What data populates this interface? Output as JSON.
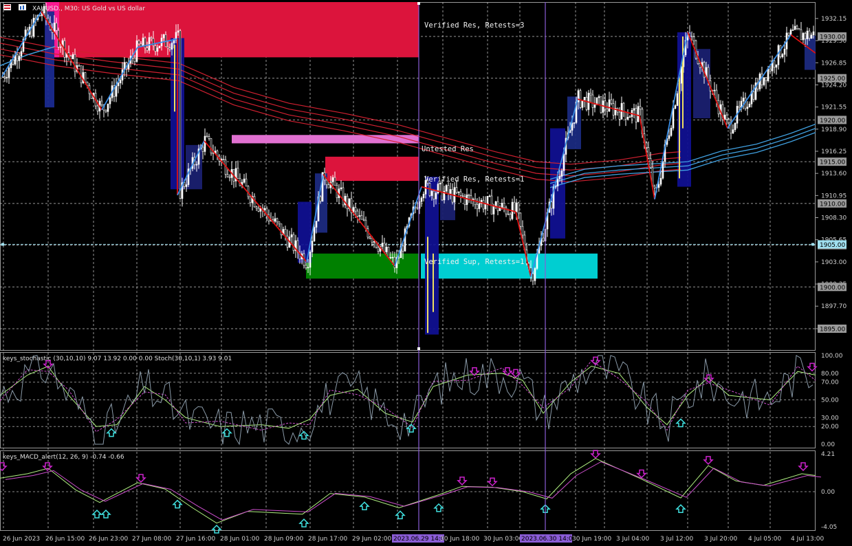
{
  "header": {
    "symbol_text": "XAUUSD., M30:  US Gold vs US dollar"
  },
  "zones": {
    "res1": "Verified Res, Retests=3",
    "res2": "Untested Res",
    "res3": "Verified Res, Retests=1",
    "sup1": "Verified Sup, Retests=1"
  },
  "stoch": {
    "title": "keys_stochastic (30,10,10) 9.07 13.92 0.00 0.00 Stoch(30,10,1) 3.93 9.01",
    "levels": [
      "100.00",
      "80.00",
      "70.00",
      "50.00",
      "30.00",
      "20.00",
      "0.00"
    ]
  },
  "macd": {
    "title": "keys_MACD_alert(12, 26, 9) -0.74 -0.66",
    "levels": [
      "4.21",
      "0.00",
      "-4.05"
    ]
  },
  "time_axis": {
    "labels": [
      "26 Jun 2023",
      "26 Jun 15:00",
      "26 Jun 23:00",
      "27 Jun 08:00",
      "27 Jun 16:00",
      "28 Jun 01:00",
      "28 Jun 09:00",
      "28 Jun 17:00",
      "29 Jun 02:00",
      "2023.06.29 14:00",
      "30 Jun 18:00",
      "30 Jun 03:00",
      "2023.06.30 14:00",
      "30 Jun 19:00",
      "3 Jul 04:00",
      "3 Jul 12:00",
      "3 Jul 20:00",
      "4 Jul 05:00",
      "4 Jul 13:00"
    ],
    "highlight_labels": [
      "2023.06.29 14:00",
      "2023.06.30 14:00"
    ]
  },
  "colors": {
    "background": "#000000",
    "grid": "#c8c8c8",
    "bull": "#ffffff",
    "bear": "#ffffff",
    "res_zone": "#dc143c",
    "untested_zone": "#e070d0",
    "sup_green": "#008000",
    "sup_cyan": "#00ced1",
    "zigzag_up": "#3a8ee6",
    "zigzag_down": "#e01010",
    "ma_red": "#d02030",
    "ma_blue": "#40a0e0",
    "vline": "#8a5cd6",
    "highlight_label_bg": "#8a5cd6",
    "alert_down": "#cc22cc",
    "alert_up": "#40e0e0"
  },
  "chart_data": {
    "type": "candlestick",
    "title": "XAUUSD., M30:  US Gold vs US dollar",
    "price_axis": {
      "ticks": [
        "1932.15",
        "1929.50",
        "1926.85",
        "1924.20",
        "1921.55",
        "1918.90",
        "1916.25",
        "1913.60",
        "1910.95",
        "1908.30",
        "1905.65",
        "1903.00",
        "1900.35",
        "1897.70",
        "1895.00"
      ],
      "boxed_levels": [
        "1930.00",
        "1925.00",
        "1920.00",
        "1915.00",
        "1910.00",
        "1905.00",
        "1900.00",
        "1895.00"
      ],
      "ylim": [
        1893.0,
        1933.5
      ]
    },
    "zigzag_points": [
      {
        "x": "26 Jun 2023",
        "y": 1925.2
      },
      {
        "x": "26 Jun 15:00",
        "y": 1933.0
      },
      {
        "x": "26 Jun 23:00",
        "y": 1921.2
      },
      {
        "x": "27 Jun 08:00",
        "y": 1928.7
      },
      {
        "x": "27 Jun 16:00",
        "y": 1929.7
      },
      {
        "x": "27 Jun 16:00",
        "y": 1911.0
      },
      {
        "x": "28 Jun 01:00",
        "y": 1917.5
      },
      {
        "x": "28 Jun 09:00",
        "y": 1903.0
      },
      {
        "x": "28 Jun 17:00",
        "y": 1913.5
      },
      {
        "x": "29 Jun 02:00",
        "y": 1902.5
      },
      {
        "x": "2023.06.29 14:00",
        "y": 1912.0
      },
      {
        "x": "30 Jun 03:00",
        "y": 1909.0
      },
      {
        "x": "30 Jun 03:00",
        "y": 1901.2
      },
      {
        "x": "30 Jun 19:00",
        "y": 1922.5
      },
      {
        "x": "3 Jul 04:00",
        "y": 1920.5
      },
      {
        "x": "3 Jul 04:00",
        "y": 1910.5
      },
      {
        "x": "3 Jul 12:00",
        "y": 1930.5
      },
      {
        "x": "3 Jul 20:00",
        "y": 1919.0
      },
      {
        "x": "4 Jul 13:00",
        "y": 1930.2
      }
    ]
  }
}
